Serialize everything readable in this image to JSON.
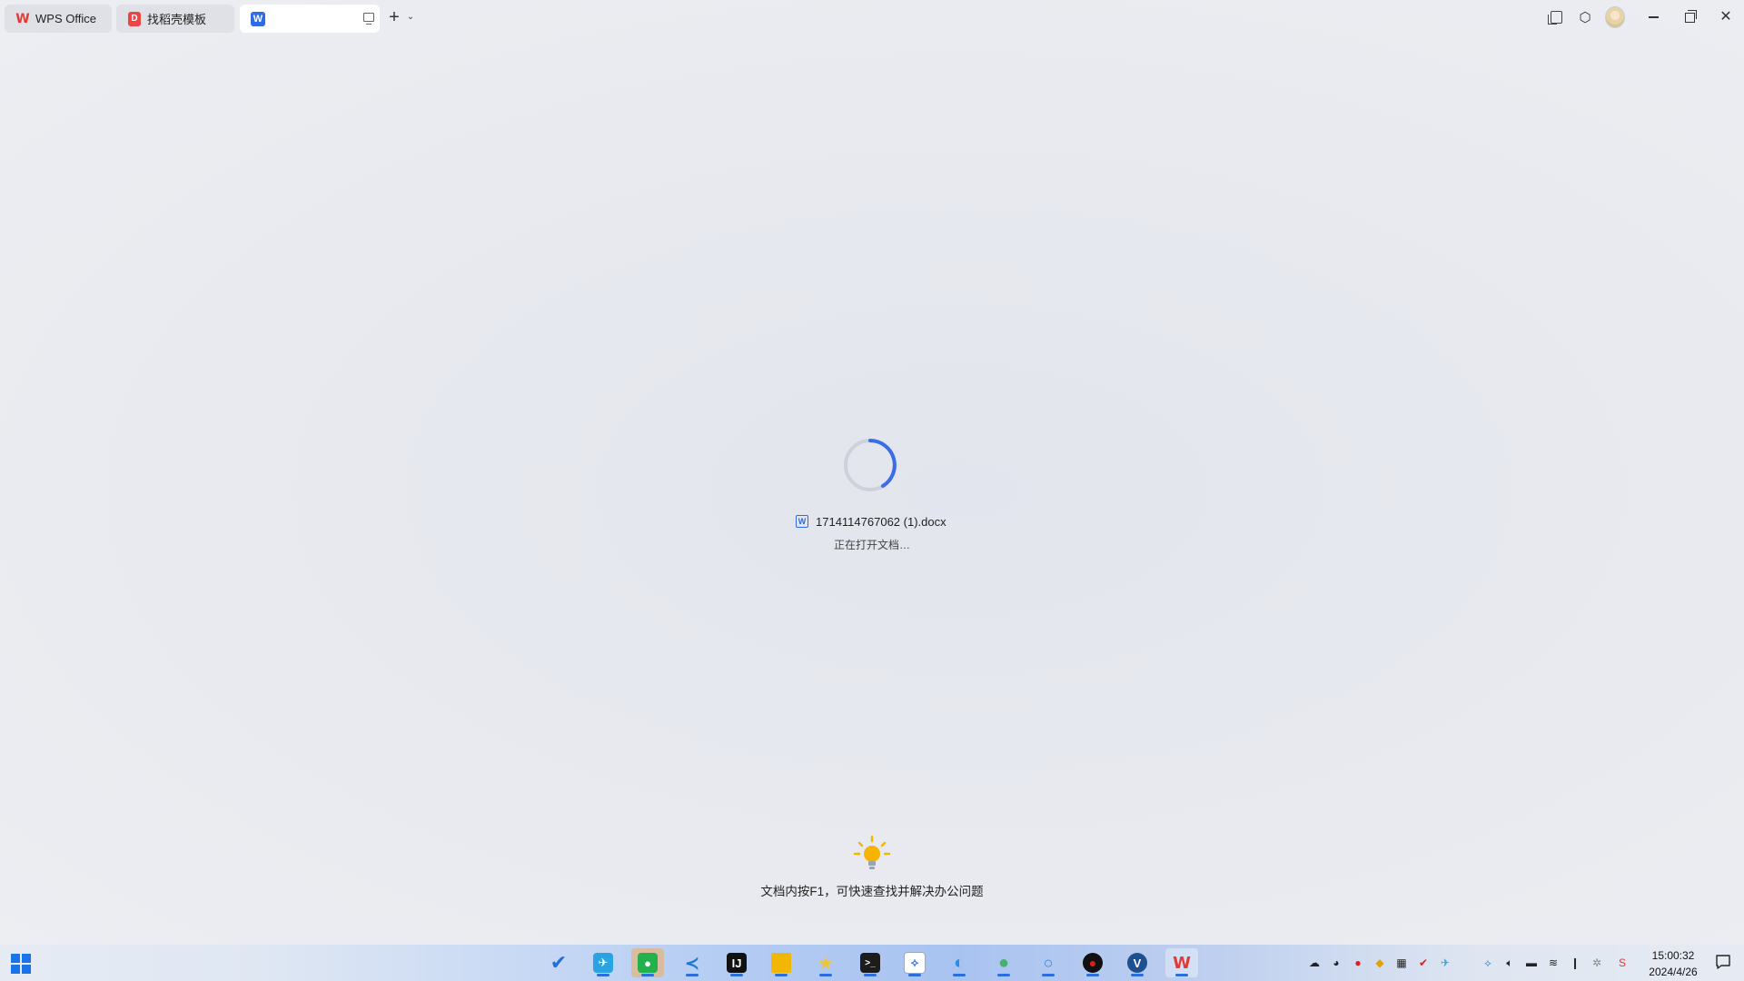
{
  "tabs": [
    {
      "label": "WPS Office",
      "icon": "wps-logo-icon"
    },
    {
      "label": "找稻壳模板",
      "icon": "daoke-template-icon"
    },
    {
      "label": "",
      "icon": "word-document-icon"
    }
  ],
  "titlebar_controls": [
    "new-tab-icon",
    "tab-menu-chevron-icon",
    "pages-icon",
    "cube-icon",
    "user-avatar",
    "minimize-icon",
    "restore-icon",
    "close-icon"
  ],
  "loading": {
    "filename": "1714114767062 (1).docx",
    "status": "正在打开文档…"
  },
  "tip": {
    "text": "文档内按F1，可快速查找并解决办公问题",
    "icon": "lightbulb-icon"
  },
  "taskbar": {
    "apps": [
      {
        "name": "todo-app-icon",
        "color": "#1f6fd8"
      },
      {
        "name": "telegram-app-icon",
        "color": "#2aa3e3"
      },
      {
        "name": "wechat-app-icon",
        "color": "#22b14c"
      },
      {
        "name": "vscode-app-icon",
        "color": "#1b7ad4"
      },
      {
        "name": "jetbrains-app-icon",
        "color": "#111111"
      },
      {
        "name": "file-explorer-app-icon",
        "color": "#f2b705"
      },
      {
        "name": "favorites-app-icon",
        "color": "#f0c43a"
      },
      {
        "name": "terminal-app-icon",
        "color": "#1c1c1c"
      },
      {
        "name": "network-app-icon",
        "color": "#3a7be0"
      },
      {
        "name": "edge-app-icon",
        "color": "#2a8be8"
      },
      {
        "name": "maps-app-icon",
        "color": "#43b36b"
      },
      {
        "name": "search-app-icon",
        "color": "#2b86e6"
      },
      {
        "name": "recorder-app-icon",
        "color": "#d92020"
      },
      {
        "name": "vpn-app-icon",
        "color": "#1e4f8f"
      },
      {
        "name": "wps-app-icon",
        "color": "#e53935"
      }
    ],
    "tray_icons": [
      "cloud-sync-icon",
      "qq-icon",
      "record-icon",
      "shield-icon",
      "grid-icon",
      "antivirus-icon",
      "telegram-tray-icon",
      "network-share-icon",
      "volume-icon",
      "battery-icon",
      "wifi-icon",
      "microphone-icon",
      "settings-icon",
      "input-method-icon"
    ],
    "time": "15:00:32",
    "date": "2024/4/26"
  },
  "accent_color": "#3b6de8"
}
